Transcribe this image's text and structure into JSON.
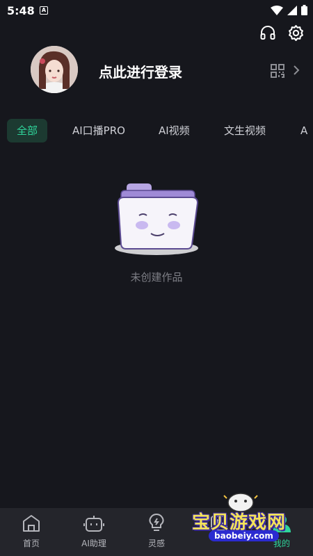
{
  "status_bar": {
    "time": "5:48",
    "notification_glyph": "A"
  },
  "profile": {
    "login_prompt": "点此进行登录"
  },
  "tabs": [
    {
      "label": "全部",
      "active": true
    },
    {
      "label": "AI口播PRO"
    },
    {
      "label": "AI视频"
    },
    {
      "label": "文生视频"
    },
    {
      "label": "A"
    }
  ],
  "empty_state": {
    "message": "未创建作品"
  },
  "bottom_nav": [
    {
      "label": "首页",
      "icon": "home-icon"
    },
    {
      "label": "AI助理",
      "icon": "robot-icon"
    },
    {
      "label": "灵感",
      "icon": "lightbulb-icon"
    },
    {
      "label": "",
      "icon": "play-icon"
    },
    {
      "label": "我的",
      "icon": "profile-icon",
      "active": true
    }
  ],
  "watermark": {
    "title": "宝贝游戏网",
    "url": "baobeiy.com"
  },
  "colors": {
    "background": "#16171d",
    "accent": "#2fd59b",
    "nav_bg": "#24252b"
  }
}
